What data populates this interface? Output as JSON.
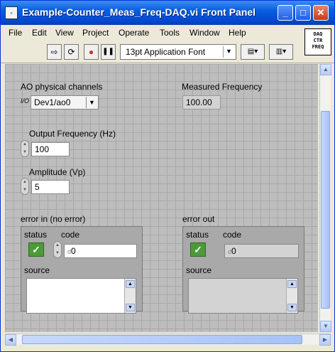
{
  "window": {
    "title": "Example-Counter_Meas_Freq-DAQ.vi Front Panel",
    "app_icon": "labview-vi-icon"
  },
  "titlebar_buttons": {
    "minimize": "_",
    "maximize": "□",
    "close": "✕"
  },
  "menu": [
    "File",
    "Edit",
    "View",
    "Project",
    "Operate",
    "Tools",
    "Window",
    "Help"
  ],
  "toolbar": {
    "run_icon": "⇨",
    "run_continuous_icon": "⟳",
    "abort_icon": "●",
    "pause_icon": "❚❚",
    "font": "13pt Application Font",
    "font_arrow": "▼",
    "align_icon": "▤▾",
    "distribute_icon": "▥▾"
  },
  "vi_icon_text": [
    "DAQ",
    "CTR",
    "FREQ"
  ],
  "controls": {
    "ao_channels": {
      "label": "AO physical channels",
      "io_icon": "I/O",
      "value": "Dev1/ao0",
      "arrow": "▼"
    },
    "measured_frequency": {
      "label": "Measured Frequency",
      "value": "100.00"
    },
    "output_frequency": {
      "label": "Output Frequency (Hz)",
      "value": "100"
    },
    "amplitude": {
      "label": "Amplitude (Vp)",
      "value": "5"
    }
  },
  "error_in": {
    "label": "error in (no error)",
    "status_label": "status",
    "code_label": "code",
    "code_value": "0",
    "code_prefix": "d",
    "source_label": "source",
    "status_mark": "✓"
  },
  "error_out": {
    "label": "error out",
    "status_label": "status",
    "code_label": "code",
    "code_value": "0",
    "code_prefix": "d",
    "source_label": "source",
    "status_mark": "✓"
  },
  "spinner": {
    "up": "▲",
    "down": "▼"
  },
  "scroll": {
    "up": "▲",
    "down": "▼",
    "left": "◀",
    "right": "▶"
  },
  "colors": {
    "title_bar": "#0a5fe0",
    "panel": "#bdbdbd",
    "status_ok": "#4c9a3a"
  }
}
